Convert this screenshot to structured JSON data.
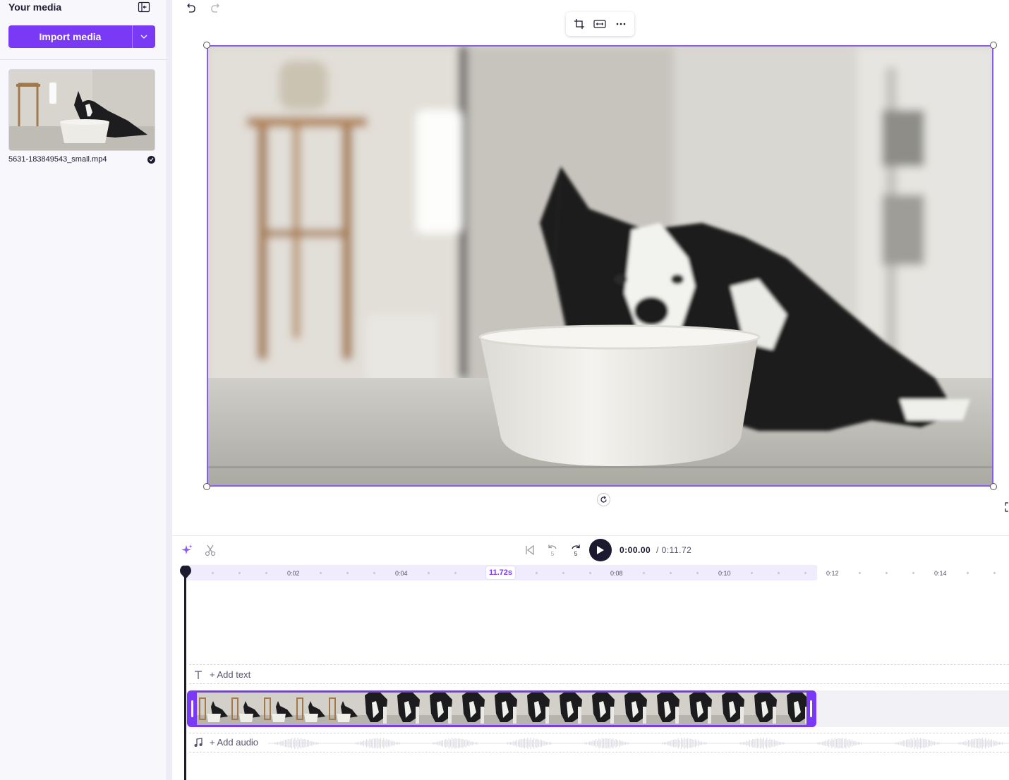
{
  "sidebar": {
    "title": "Your media",
    "import_label": "Import media",
    "media": [
      {
        "filename": "5631-183849543_small.mp4",
        "status": "uploaded"
      }
    ]
  },
  "toolbar": {
    "undo_icon": "undo-icon",
    "redo_icon": "redo-icon",
    "floating_icons": [
      "crop-icon",
      "fit-icon",
      "more-icon"
    ]
  },
  "transport": {
    "current_time": "0:00.00",
    "total_time": "/ 0:11.72",
    "skip_back_label": "5",
    "skip_forward_label": "5"
  },
  "ruler": {
    "ticks": [
      "0:02",
      "0:04",
      "0:08",
      "0:10",
      "0:12",
      "0:14"
    ],
    "clip_duration": "11.72s"
  },
  "tracks": {
    "add_text": "+ Add text",
    "add_audio": "+ Add audio"
  },
  "colors": {
    "accent": "#7a3af5",
    "selection": "#8a5cf6",
    "ink": "#1b1a2e"
  }
}
